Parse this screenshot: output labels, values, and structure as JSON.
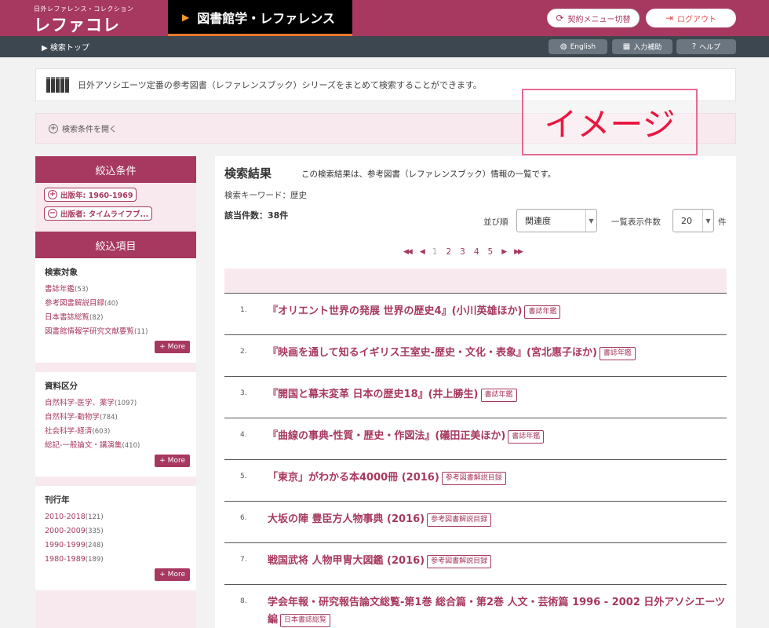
{
  "header": {
    "logo_sub": "日外レファレンス・コレクション",
    "logo_main": "レファコレ",
    "db_title": "図書館学・レファレンス",
    "switch_label": "契約メニュー切替",
    "logout_label": "ログアウト"
  },
  "subbar": {
    "breadcrumb": "検索トップ",
    "english_label": "English",
    "input_help_label": "入力補助",
    "help_label": "ヘルプ"
  },
  "info": {
    "text": "日外アソシエーツ定番の参考図書（レファレンスブック）シリーズをまとめて検索することができます。"
  },
  "search_open": {
    "label": "検索条件を開く"
  },
  "stamp": {
    "text": "イメージ"
  },
  "sidebar": {
    "filter_heading": "絞込条件",
    "chips": [
      {
        "label": "出版年: 1960-1969"
      },
      {
        "label": "出版者: タイムライフブ..."
      }
    ],
    "facet_heading": "絞込項目",
    "more_label": "+ More",
    "groups": [
      {
        "title": "検索対象",
        "items": [
          {
            "label": "書誌年鑑",
            "count": "(53)"
          },
          {
            "label": "参考図書解説目録",
            "count": "(40)"
          },
          {
            "label": "日本書誌総覧",
            "count": "(82)"
          },
          {
            "label": "図書館情報学研究文献要覧",
            "count": "(11)"
          }
        ]
      },
      {
        "title": "資料区分",
        "items": [
          {
            "label": "自然科学-医学、薬学",
            "count": "(1097)"
          },
          {
            "label": "自然科学-動物学",
            "count": "(784)"
          },
          {
            "label": "社会科学-経済",
            "count": "(603)"
          },
          {
            "label": "総記-一般論文・講演集",
            "count": "(410)"
          }
        ]
      },
      {
        "title": "刊行年",
        "items": [
          {
            "label": "2010-2018",
            "count": "(121)"
          },
          {
            "label": "2000-2009",
            "count": "(335)"
          },
          {
            "label": "1990-1999",
            "count": "(248)"
          },
          {
            "label": "1980-1989",
            "count": "(189)"
          }
        ]
      }
    ]
  },
  "results": {
    "title": "検索結果",
    "description": "この検索結果は、参考図書（レファレンスブック）情報の一覧です。",
    "keyword": "検索キーワード：歴史",
    "count": "該当件数：38件",
    "sort_label": "並び順",
    "sort_value": "関連度",
    "perpage_label": "一覧表示件数",
    "perpage_value": "20",
    "perpage_unit": "件",
    "pages": [
      "1",
      "2",
      "3",
      "4",
      "5"
    ],
    "current_page": "1",
    "items": [
      {
        "num": "1.",
        "title": "『オリエント世界の発展 世界の歴史4』(小川英雄ほか)",
        "badge": "書誌年鑑"
      },
      {
        "num": "2.",
        "title": "『映画を通して知るイギリス王室史-歴史・文化・表象』(宮北惠子ほか)",
        "badge": "書誌年鑑"
      },
      {
        "num": "3.",
        "title": "『開国と幕末変革 日本の歴史18』(井上勝生)",
        "badge": "書誌年鑑"
      },
      {
        "num": "4.",
        "title": "『曲線の事典-性質・歴史・作図法』(礒田正美ほか)",
        "badge": "書誌年鑑"
      },
      {
        "num": "5.",
        "title": "「東京」がわかる本4000冊 (2016)",
        "badge": "参考図書解説目録"
      },
      {
        "num": "6.",
        "title": "大坂の陣 豊臣方人物事典 (2016)",
        "badge": "参考図書解説目録"
      },
      {
        "num": "7.",
        "title": "戦国武将 人物甲冑大図鑑 (2016)",
        "badge": "参考図書解説目録"
      },
      {
        "num": "8.",
        "title": "学会年報・研究報告論文総覧-第1巻 総合篇・第2巻 人文・芸術篇 1996 - 2002 日外アソシエーツ編",
        "badge": "日本書誌総覧"
      }
    ]
  }
}
